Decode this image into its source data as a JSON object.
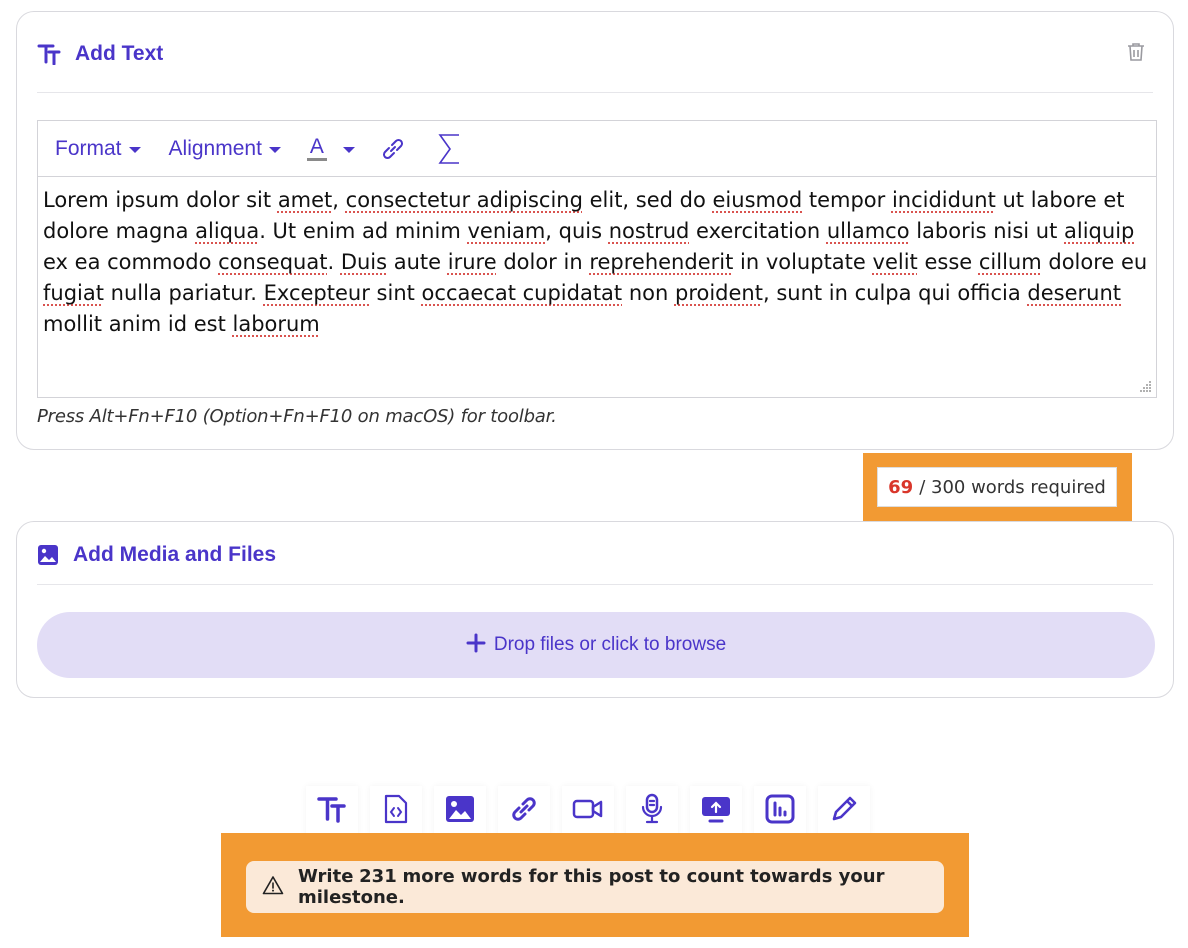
{
  "text_card": {
    "title": "Add Text",
    "toolbar": {
      "format_label": "Format",
      "alignment_label": "Alignment",
      "color_label": "A"
    },
    "body_segments": [
      {
        "t": "Lorem ipsum dolor sit "
      },
      {
        "t": "amet",
        "sp": true
      },
      {
        "t": ", "
      },
      {
        "t": "consectetur adipiscing",
        "sp": true
      },
      {
        "t": " elit, sed do "
      },
      {
        "t": "eiusmod",
        "sp": true
      },
      {
        "t": " tempor "
      },
      {
        "t": "incididunt",
        "sp": true
      },
      {
        "t": " ut labore et dolore magna "
      },
      {
        "t": "aliqua",
        "sp": true
      },
      {
        "t": ". Ut enim ad minim "
      },
      {
        "t": "veniam",
        "sp": true
      },
      {
        "t": ", quis "
      },
      {
        "t": "nostrud",
        "sp": true
      },
      {
        "t": " exercitation "
      },
      {
        "t": "ullamco",
        "sp": true
      },
      {
        "t": " laboris nisi ut "
      },
      {
        "t": "aliquip",
        "sp": true
      },
      {
        "t": " ex ea commodo "
      },
      {
        "t": "consequat",
        "sp": true
      },
      {
        "t": ". "
      },
      {
        "t": "Duis",
        "sp": true
      },
      {
        "t": " aute "
      },
      {
        "t": "irure",
        "sp": true
      },
      {
        "t": " dolor in "
      },
      {
        "t": "reprehenderit",
        "sp": true
      },
      {
        "t": " in voluptate "
      },
      {
        "t": "velit",
        "sp": true
      },
      {
        "t": " esse "
      },
      {
        "t": "cillum",
        "sp": true
      },
      {
        "t": " dolore eu "
      },
      {
        "t": "fugiat",
        "sp": true
      },
      {
        "t": " nulla pariatur. "
      },
      {
        "t": "Excepteur",
        "sp": true
      },
      {
        "t": " sint "
      },
      {
        "t": "occaecat cupidatat",
        "sp": true
      },
      {
        "t": " non "
      },
      {
        "t": "proident",
        "sp": true
      },
      {
        "t": ", sunt in culpa qui officia "
      },
      {
        "t": "deserunt",
        "sp": true
      },
      {
        "t": " mollit anim id est "
      },
      {
        "t": "laborum",
        "sp": true
      }
    ],
    "hint": "Press Alt+Fn+F10 (Option+Fn+F10 on macOS) for toolbar."
  },
  "word_count": {
    "current": "69",
    "suffix": "/ 300 words required"
  },
  "media_card": {
    "title": "Add Media and Files",
    "dropzone_label": "Drop files or click to browse"
  },
  "add_bar": {
    "items": [
      "text-icon",
      "code-file-icon",
      "image-icon",
      "link-icon",
      "video-icon",
      "microphone-icon",
      "screen-share-icon",
      "poll-icon",
      "pencil-icon"
    ]
  },
  "warning": {
    "prefix": "Write",
    "count": "231",
    "suffix": "more words for this post to count towards your milestone."
  },
  "colors": {
    "accent": "#4a35c9",
    "highlight": "#f29a33",
    "count_red": "#d9362b",
    "dropzone_bg": "#e2ddf6",
    "warning_bg": "#fbe9d8"
  }
}
